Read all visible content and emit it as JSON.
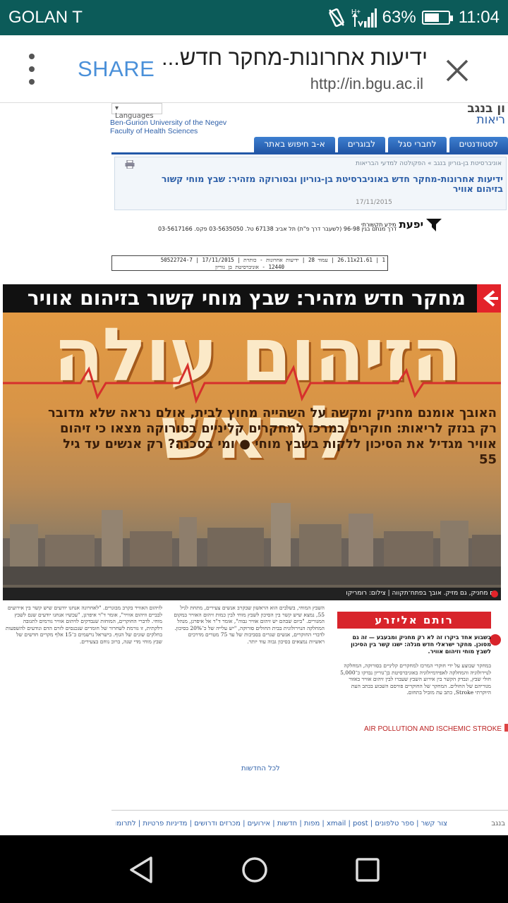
{
  "status_bar": {
    "carrier": "GOLAN T",
    "battery": "63%",
    "battery_level": 0.63,
    "time": "11:04"
  },
  "app_bar": {
    "share_label": "SHARE",
    "title": "ידיעות אחרונות-מחקר חדש...",
    "url": "http://in.bgu.ac.il"
  },
  "site": {
    "languages_label": "Languages",
    "university_line1": "Ben-Gurion University of the Negev",
    "university_line2": "Faculty of Health Sciences",
    "right_cut_top": "ון בנגב",
    "right_cut_bottom": "ריאות",
    "nav_tabs": [
      "לסטודנטים",
      "לחברי סגל",
      "לבוגרים",
      "א-ב חיפוש באתר"
    ],
    "breadcrumb": "אוניברסיטת בן-גוריון בנגב » הפקולטה למדעי הבריאות",
    "article_title": "ידיעות אחרונות-מחקר חדש באוניברסיטת בן-גוריון ובסורוקה מזהיר: שבץ מוחי קשור בזיהום אוויר",
    "article_date": "17/11/2015"
  },
  "clipping": {
    "logo": "יפעת",
    "logo_sub": "מידע תקשורתי",
    "contact": "דרך מנחם בגין 96-98 (לשעבר דרך פ\"ת) תל אביב 67138 טל. 03-5635050 פקס. 03-5617166",
    "table_row1": "26.11x21.61 | 1 | עמוד 28 | ידיעות אחרונות - כותרת | 17/11/2015 | 50522724-7",
    "table_row2": "12440 - אוניברסיטת בן גוריון"
  },
  "newspaper": {
    "headline": "מחקר חדש מזהיר: שבץ מוחי קשור בזיהום אוויר",
    "big_title": "הזיהום עולה לראש",
    "subtitle": "האובך אומנם מחניק ומקשה על השהייה מחוץ לבית, אולם נראה שלא מדובר רק בנזק לריאות: חוקרים במרכז למחקרים קליניים בסורוקה מצאו כי זיהום אוויר מגדיל את הסיכון ללקות בשבץ מוחי ● ומי בסכנה? רק אנשים עד גיל 55",
    "caption": "גם מחניק, גם מזיק. אובך בפתח־תקווה | צילום: רומריקו"
  },
  "article": {
    "author": "רותם אליזרע",
    "lead": "בשבוע אחד ביקרו זה לא רק מחניק ומבעבע — זה גם מסוכן. מחקר ישראלי חדש מגלה: ישנו קשר בין הסיכון לשבץ מוחי וזיהום אוויר.",
    "col1": "במחקר שבוצע על ידי חוקרי המרכז למחקרים קליניים בסורוקה, המחלקה לנוירולוגיה והמחלקה לאפידמיולוגיה באוניברסיטת בן־גוריון נבדקו כ־5,000 חולי שבץ, ונבדק הקשר בין אירוע השבץ שעברו לבין זיהום אוויר באזור מגוריהם של החולים. המחקר של החוקרים פורסם השבוע בכתב העת היוקרתי Stroke, כתב עת מוביל בתחום.",
    "col2": "השבץ המוחי, בשלבים הוא הראשון שבקרב אנשים צעירים, מתחת לגיל 55, נמצא שיש קשר בין הסיכון לשבץ מוחי לבין כמות זיהום האוויר במקום המגורים. \"ביום שבהם יש זיהום אוויר גבוה\", אומר ד\"ר אל איפרגן, מנהל המחלקה הנוירולוגית בבית החולים סורוקה, \"יש עלייה של כ־20% בסיכון. לדברי החוקרים, אנשים שגרים בסביבות של עד 75 מטרים מדרכים ראשיות נמצאים בסיכון גבוה עוד יותר.",
    "col3": "לזיהום האוויר בקרב מבוגרים. \"לאחרונה אנחנו יודעים שיש קשר בין אירועים לבביים וזיהום אוויר\", אומר ד\"ר איפרגן, \"עכשיו אנחנו יודעים שגם לשבץ מוחי. לדברי החוקרים, המוחות שנבדקים לזיהום אוויר גורמים לתגובה דלקתית, זו גורמת לשחרור של חומרים שנכנסים לזרם הדם ונודעים להשפעות בחלקים שונים של הגוף. בישראל נרשמים כ־15 אלף מקרים חדשים של שבץ מוחי מדי שנה, ברוב נוחם בצעירים."
  },
  "links": {
    "pdf": "AIR POLLUTION AND ISCHEMIC STROKE",
    "all_news": "לכל החדשות",
    "footer": "צור קשר | ספר טלפונים | xmail | post | מפות | חדשות | אירועים | מכרזים ודרושים | מדיניות פרטיות | לתרומות",
    "footer_cut": "בנגב"
  }
}
